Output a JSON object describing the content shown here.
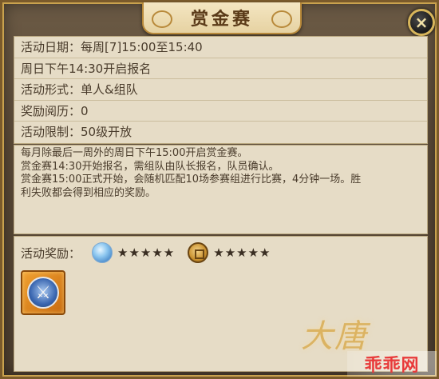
{
  "title": "赏金赛",
  "close_label": "×",
  "info": [
    "活动日期：每周[7]15:00至15:40",
    "周日下午14:30开启报名",
    "活动形式：单人&组队",
    "奖励阅历：0",
    "活动限制：50级开放"
  ],
  "description": [
    "每月除最后一周外的周日下午15:00开启赏金赛。",
    "赏金赛14:30开始报名，需组队由队长报名，队员确认。",
    "赏金赛15:00正式开始，会随机匹配10场参赛组进行比赛，4分钟一场。胜",
    "利失败都会得到相应的奖励。"
  ],
  "rewards": {
    "label": "活动奖励：",
    "gem_stars": "★★★★★",
    "coin_stars": "★★★★★",
    "gem_icon": "blue-gem-icon",
    "coin_icon": "copper-coin-icon",
    "item_icon": "sword-shield-emblem-icon"
  },
  "watermark": {
    "game_logo": "大唐",
    "site": "乖乖网"
  },
  "colors": {
    "panel": "#5b4a37",
    "paper": "#e6dcc6",
    "text": "#4a3c2c",
    "gold": "#c9a24e",
    "site_red": "#e83a3a"
  }
}
